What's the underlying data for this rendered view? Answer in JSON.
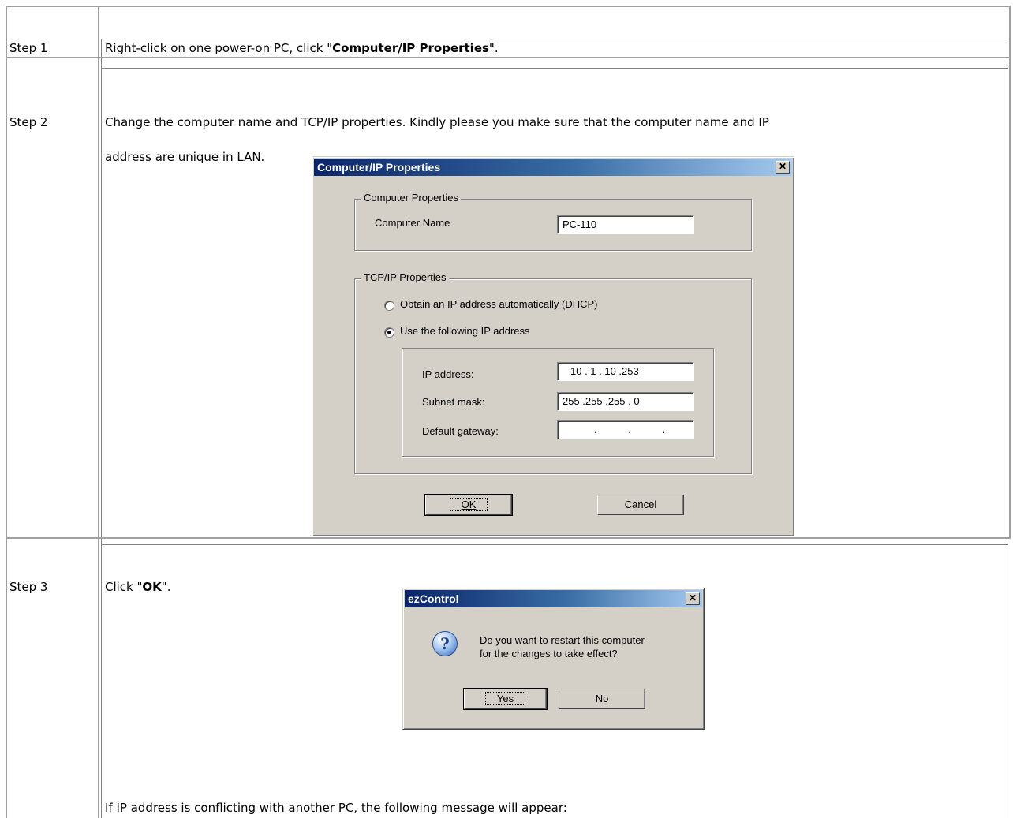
{
  "steps": [
    {
      "label": "Step 1",
      "text_before": "Right-click on one power-on PC, click \"",
      "text_bold": "Computer/IP Properties",
      "text_after": "\"."
    },
    {
      "label": "Step 2",
      "line1": "Change the computer name and TCP/IP properties. Kindly please you make sure that the computer name and IP",
      "line2": "address are unique in LAN."
    },
    {
      "label": "Step 3",
      "text_before": "Click \"",
      "text_bold": "OK",
      "text_after": "\".",
      "footer": "If IP address is conflicting with another PC, the following message will appear:"
    }
  ],
  "ip_dialog": {
    "title": "Computer/IP Properties",
    "close_glyph": "✕",
    "computer_group_label": "Computer Properties",
    "computer_name_label": "Computer Name",
    "computer_name_value": "PC-110",
    "tcpip_group_label": "TCP/IP Properties",
    "radio_dhcp_label": "Obtain an IP address automatically (DHCP)",
    "radio_dhcp_selected": false,
    "radio_static_label": "Use the following IP address",
    "radio_static_selected": true,
    "ip_address_label": "IP address:",
    "ip_address_value": "10 . 1 . 10 .253",
    "subnet_mask_label": "Subnet mask:",
    "subnet_mask_value": "255 .255 .255 . 0",
    "gateway_label": "Default gateway:",
    "gateway_value": ". . .",
    "ok_label": "OK",
    "cancel_label": "Cancel"
  },
  "confirm_dialog": {
    "title": "ezControl",
    "close_glyph": "✕",
    "icon": "question-icon",
    "message_line1": "Do you want to restart this computer",
    "message_line2": "for the changes to take effect?",
    "yes_label": "Yes",
    "no_label": "No"
  }
}
